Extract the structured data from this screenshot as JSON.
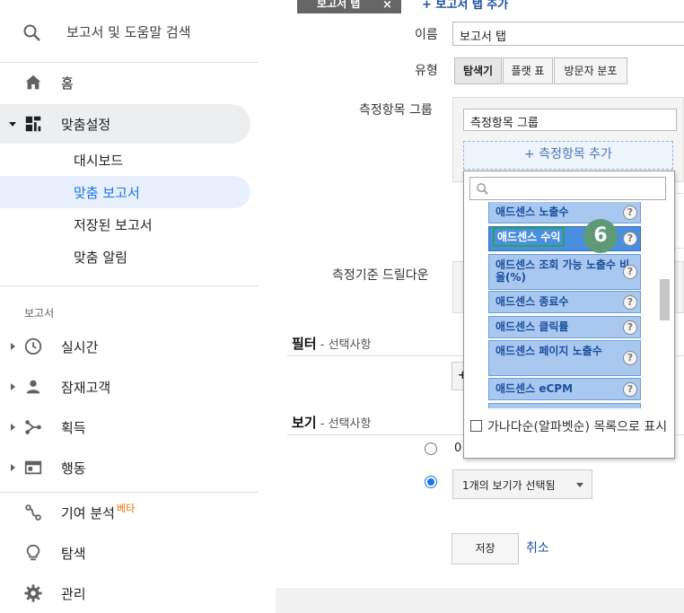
{
  "sidebar": {
    "search_label": "보고서 및 도움말 검색",
    "home_label": "홈",
    "custom_label": "맞춤설정",
    "custom_items": [
      "대시보드",
      "맞춤 보고서",
      "저장된 보고서",
      "맞춤 알림"
    ],
    "section_reports": "보고서",
    "report_items": [
      "실시간",
      "잠재고객",
      "획득",
      "행동"
    ],
    "attribution_label": "기여 분석",
    "attribution_badge": "베타",
    "discover_label": "탐색",
    "admin_label": "관리"
  },
  "tabs": {
    "current_tab": "보고서 탭",
    "close_glyph": "×",
    "add_tab": "+ 보고서 탭 추가"
  },
  "form": {
    "name_label": "이름",
    "name_value": "보고서 탭",
    "type_label": "유형",
    "type_options": [
      "탐색기",
      "플랫 표",
      "방문자 분포"
    ],
    "metric_group_label": "측정항목 그룹",
    "metric_group_value": "측정항목 그룹",
    "add_metric": "+ 측정항목 추가",
    "drilldown_label": "측정기준 드릴다운",
    "filter_title": "필터",
    "filter_optional": " - 선택사항",
    "filter_add": "+",
    "view_title": "보기",
    "view_optional": " - 선택사항",
    "view_radio_all": "0",
    "view_select_value": "1개의 보기가 선택됨",
    "save": "저장",
    "cancel": "취소"
  },
  "dropdown": {
    "search_placeholder": "",
    "items": [
      {
        "label": "애드센스 노출수",
        "highlighted": false
      },
      {
        "label": "애드센스 수익",
        "highlighted": true
      },
      {
        "label": "애드센스 조회 가능 노출수 비율(%)",
        "highlighted": false
      },
      {
        "label": "애드센스 종료수",
        "highlighted": false
      },
      {
        "label": "애드센스 클릭률",
        "highlighted": false
      },
      {
        "label": "애드센스 페이지 노출수",
        "highlighted": false
      },
      {
        "label": "애드센스 eCPM",
        "highlighted": false
      }
    ],
    "help_glyph": "?",
    "sort_checkbox_label": "가나다순(알파벳순) 목록으로 표시"
  },
  "annotation": {
    "step_number": "6"
  },
  "colors": {
    "accent": "#1a73e8",
    "item_bg": "#a8c8f0",
    "item_highlight": "#4a8ee0",
    "badge": "#5f9a76"
  }
}
